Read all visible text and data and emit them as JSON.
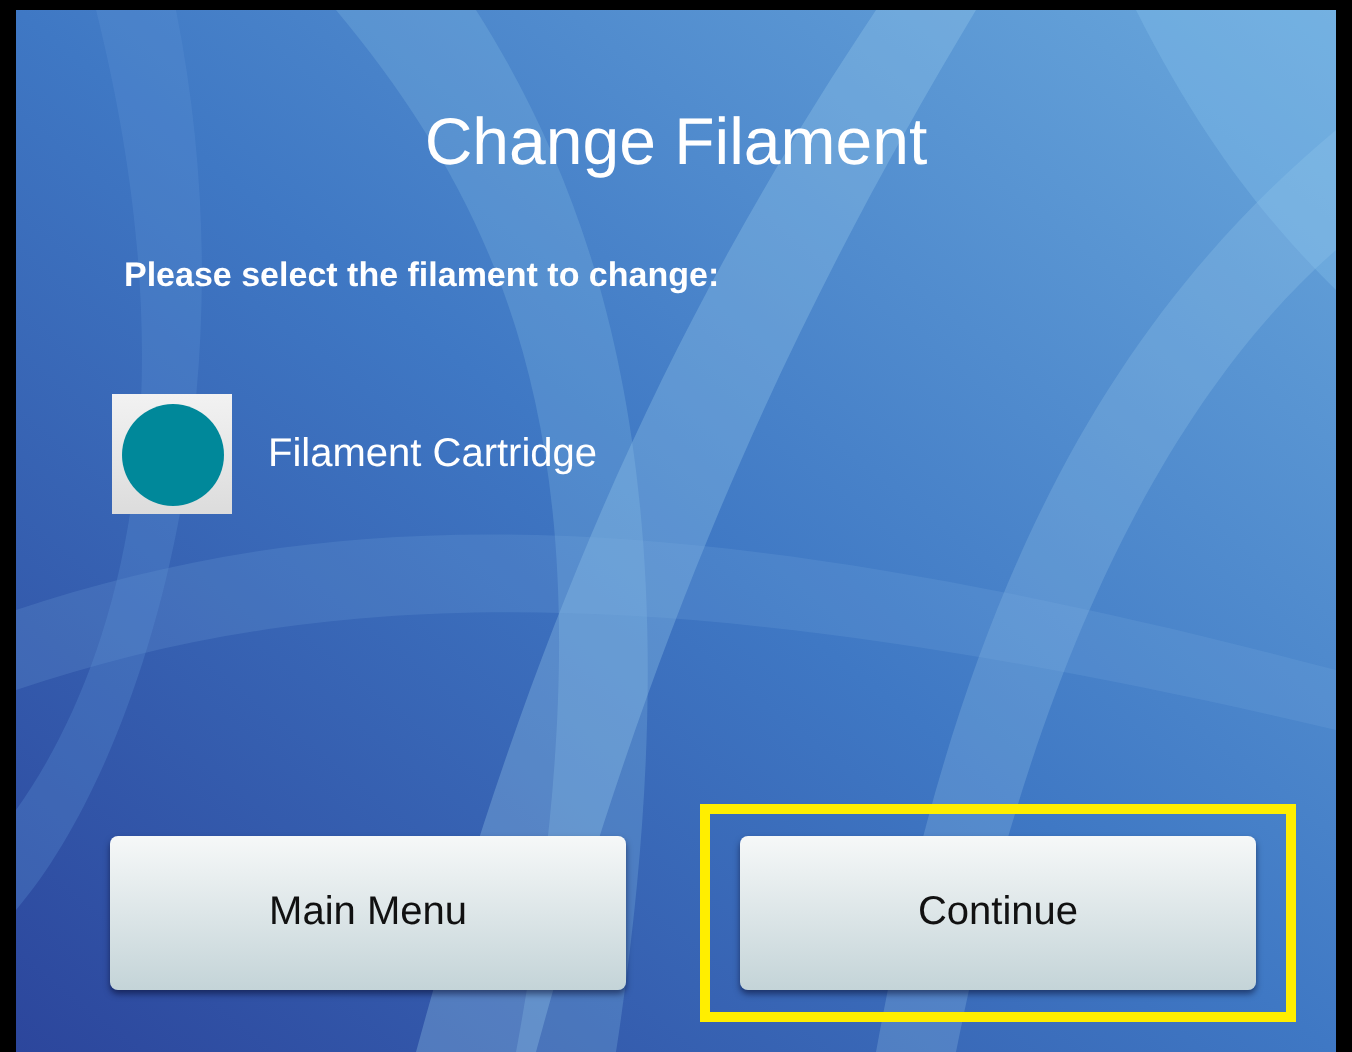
{
  "title": "Change Filament",
  "prompt": "Please select the filament to change:",
  "filaments": [
    {
      "label": "Filament Cartridge",
      "color": "#00889a"
    }
  ],
  "buttons": [
    {
      "label": "Main Menu",
      "highlighted": false
    },
    {
      "label": "Continue",
      "highlighted": true
    }
  ]
}
